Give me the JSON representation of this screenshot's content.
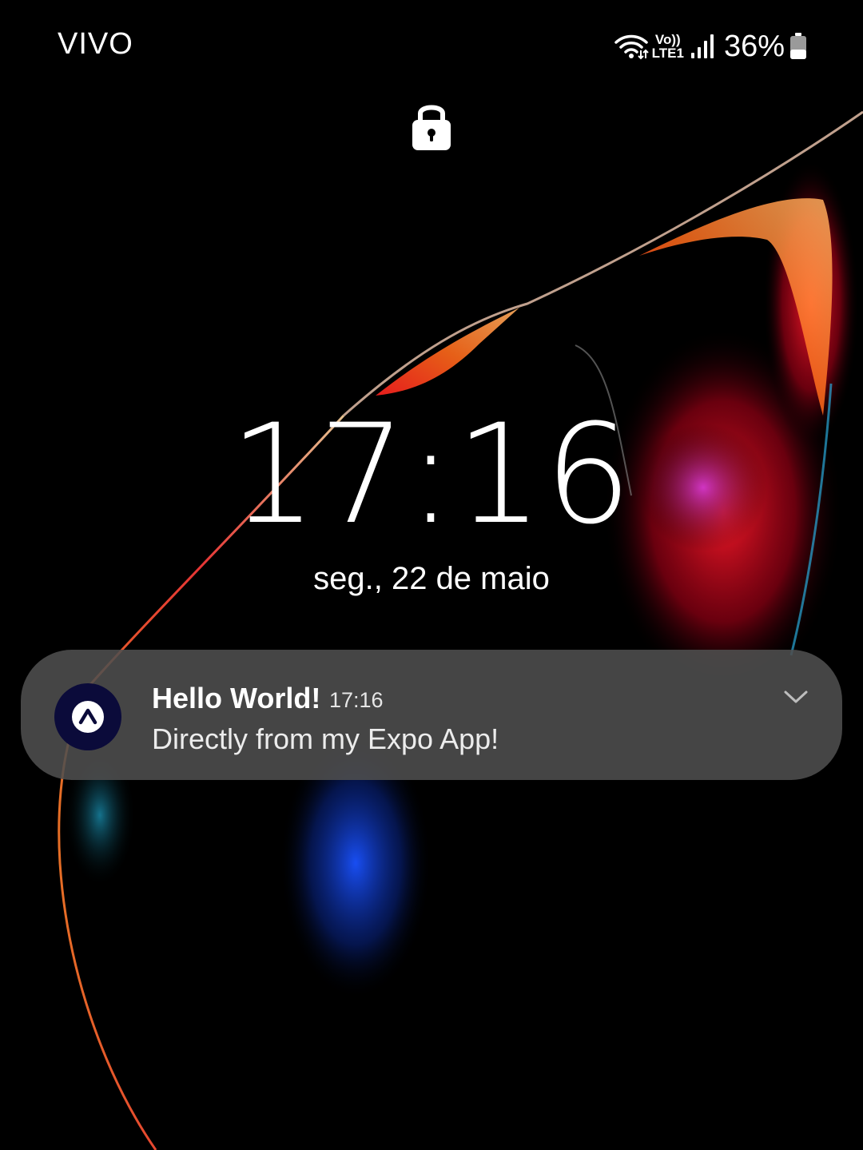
{
  "status_bar": {
    "carrier": "VIVO",
    "volte": "Vo))",
    "network": "LTE1",
    "battery_percent": "36%",
    "icons": [
      "wifi-icon",
      "signal-icon",
      "battery-icon"
    ]
  },
  "lock_screen": {
    "time": "17:16",
    "date": "seg., 22 de maio"
  },
  "notification": {
    "title": "Hello World!",
    "time": "17:16",
    "body": "Directly from my Expo App!",
    "app_icon": "expo-app-icon",
    "expand_icon": "chevron-down-icon"
  },
  "colors": {
    "background": "#000000",
    "notification_bg": "#4e4e4e",
    "app_icon_bg": "#0b0b3a",
    "wallpaper_accents": [
      "#ff2a2a",
      "#ff7a1a",
      "#c42bd6",
      "#1f55ff"
    ]
  }
}
